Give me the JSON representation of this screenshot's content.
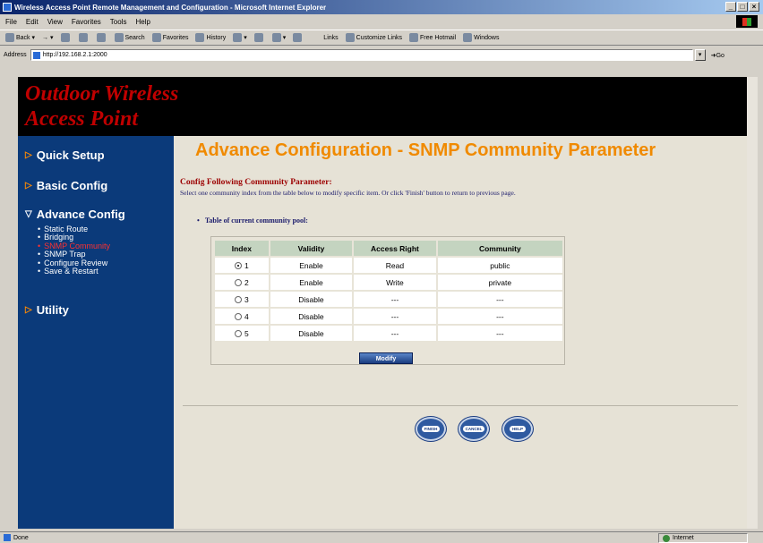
{
  "window": {
    "title": "Wireless Access Point Remote Management and Configuration - Microsoft Internet Explorer"
  },
  "menu": [
    "File",
    "Edit",
    "View",
    "Favorites",
    "Tools",
    "Help"
  ],
  "toolbar": {
    "back": "Back",
    "search": "Search",
    "favorites": "Favorites",
    "history": "History",
    "links": "Links",
    "customize_links": "Customize Links",
    "free_hotmail": "Free Hotmail",
    "windows": "Windows"
  },
  "address": {
    "label": "Address",
    "url": "http://192.168.2.1:2000",
    "go": "Go"
  },
  "banner": {
    "line1": "Outdoor Wireless",
    "line2": "Access Point"
  },
  "sidebar": {
    "quick_setup": "Quick Setup",
    "basic_config": "Basic Config",
    "advance_config": "Advance Config",
    "sub_items": [
      "Static Route",
      "Bridging",
      "SNMP Community",
      "SNMP Trap",
      "Configure Review",
      "Save & Restart"
    ],
    "utility": "Utility"
  },
  "content": {
    "title": "Advance Configuration - SNMP Community Parameter",
    "section_heading": "Config Following Community Parameter:",
    "instructions": "Select one community index from the table below to modify specific item. Or click 'Finish' button to return to previous page.",
    "table_caption": "Table of current community pool:",
    "columns": [
      "Index",
      "Validity",
      "Access Right",
      "Community"
    ],
    "rows": [
      {
        "index": "1",
        "validity": "Enable",
        "access": "Read",
        "community": "public",
        "selected": true
      },
      {
        "index": "2",
        "validity": "Enable",
        "access": "Write",
        "community": "private",
        "selected": false
      },
      {
        "index": "3",
        "validity": "Disable",
        "access": "---",
        "community": "---",
        "selected": false
      },
      {
        "index": "4",
        "validity": "Disable",
        "access": "---",
        "community": "---",
        "selected": false
      },
      {
        "index": "5",
        "validity": "Disable",
        "access": "---",
        "community": "---",
        "selected": false
      }
    ],
    "modify_label": "Modify",
    "finish_label": "FINISH",
    "cancel_label": "CANCEL",
    "help_label": "HELP"
  },
  "status": {
    "left": "Done",
    "zone": "Internet"
  }
}
